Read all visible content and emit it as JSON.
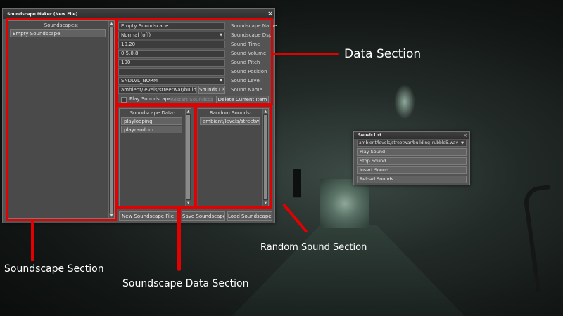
{
  "window": {
    "title": "Soundscape Maker (New File)",
    "close_glyph": "×"
  },
  "soundscapes": {
    "header": "Soundscapes:",
    "items": [
      "Empty Soundscape"
    ]
  },
  "data_section": {
    "fields": [
      {
        "value": "Empty Soundscape",
        "label": "Soundscape Name",
        "type": "text"
      },
      {
        "value": "Normal (off)",
        "label": "Soundscape Dsp",
        "type": "dropdown"
      },
      {
        "value": "10,20",
        "label": "Sound Time",
        "type": "text"
      },
      {
        "value": "0.5,0.8",
        "label": "Sound Volume",
        "type": "text"
      },
      {
        "value": "100",
        "label": "Sound Pitch",
        "type": "text"
      },
      {
        "value": "",
        "label": "Sound Position",
        "type": "text"
      },
      {
        "value": "SNDLVL_NORM",
        "label": "Sound Level",
        "type": "dropdown"
      }
    ],
    "sound_name": {
      "value": "ambient/levels/streetwar/building_ru",
      "button": "Sounds List",
      "label": "Sound Name"
    },
    "play_soundscape_label": "Play Soundscape",
    "edit_soundscape_label": "Restart Soundscape",
    "delete_label": "Delete Current Item"
  },
  "soundscape_data": {
    "header": "Soundscape Data:",
    "items": [
      "playlooping",
      "playrandom"
    ]
  },
  "random_sounds": {
    "header": "Random Sounds:",
    "items": [
      "ambient/levels/streetwar/..."
    ]
  },
  "bottom_buttons": {
    "new_file": "New Soundscape File",
    "save": "Save Soundscapes",
    "load": "Load Soundscapes"
  },
  "sounds_list_popup": {
    "title": "Sounds List",
    "close_glyph": "×",
    "selected": "ambient/levels/streetwar/building_rubble5.wav",
    "buttons": [
      "Play Sound",
      "Stop Sound",
      "Insert Sound",
      "Reload Sounds"
    ]
  },
  "annotations": {
    "data_section": "Data Section",
    "random_sound_section": "Random Sound Section",
    "soundscape_section": "Soundscape Section",
    "soundscape_data_section": "Soundscape Data Section"
  },
  "colors": {
    "annotation_red": "#e30000",
    "panel_bg": "#545454"
  }
}
